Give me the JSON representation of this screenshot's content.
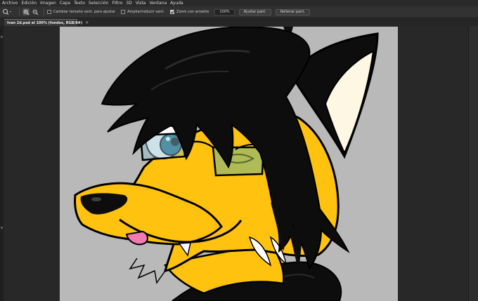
{
  "menu": {
    "items": [
      "Archivo",
      "Edición",
      "Imagen",
      "Capa",
      "Texto",
      "Selección",
      "Filtro",
      "3D",
      "Vista",
      "Ventana",
      "Ayuda"
    ]
  },
  "options_bar": {
    "resize_windows_label": "Cambiar tamaño vent. para ajustar",
    "resize_windows_checked": false,
    "zoom_all_label": "Ampliar/reducir vent.",
    "zoom_all_checked": false,
    "scrubby_zoom_label": "Zoom con arrastre",
    "scrubby_zoom_checked": true,
    "zoom_value": "100%",
    "fit_screen_label": "Ajustar pant.",
    "fill_screen_label": "Rellenar pant."
  },
  "document": {
    "tab_title": "Ivan 2d.psd al 100% (fondos, RGB/8#)",
    "close_glyph": "×"
  },
  "icons": {
    "tool": "zoom-tool-icon",
    "zoom_in": "zoom-in-icon",
    "zoom_out": "zoom-out-icon"
  },
  "colors": {
    "canvas_bg": "#b9b9b9",
    "fur": "#ffc20e",
    "hair": "#0d0d0d",
    "ear_inner": "#fdf7e4",
    "eye": "#1f6e86",
    "lens_left": "#8fbccc",
    "lens_right": "#9cb86a",
    "tongue": "#f17ab0"
  }
}
